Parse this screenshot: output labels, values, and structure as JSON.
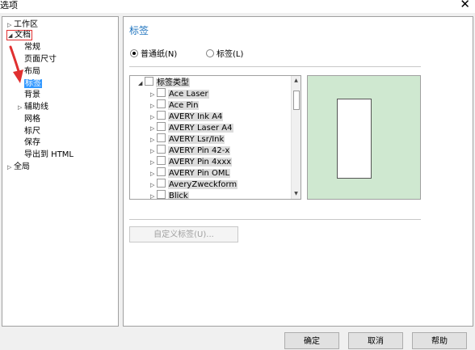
{
  "window": {
    "title": "选项",
    "close_glyph": "✕"
  },
  "tree": {
    "items": [
      {
        "label": "工作区"
      },
      {
        "label": "文档"
      },
      {
        "label": "常规"
      },
      {
        "label": "页面尺寸"
      },
      {
        "label": "布局"
      },
      {
        "label": "标签"
      },
      {
        "label": "背景"
      },
      {
        "label": "辅助线"
      },
      {
        "label": "网格"
      },
      {
        "label": "标尺"
      },
      {
        "label": "保存"
      },
      {
        "label": "导出到 HTML"
      },
      {
        "label": "全局"
      }
    ]
  },
  "section": {
    "heading": "标签",
    "radio_normal": "普通纸(N)",
    "radio_label": "标签(L)"
  },
  "label_types": {
    "root": "标签类型",
    "items": [
      "Ace Laser",
      "Ace Pin",
      "AVERY Ink A4",
      "AVERY Laser A4",
      "AVERY Lsr/Ink",
      "AVERY Pin 42-x",
      "AVERY Pin 4xxx",
      "AVERY Pin OML",
      "AveryZweckform",
      "Blick"
    ]
  },
  "custom_label_button": "自定义标签(U)...",
  "buttons": {
    "ok": "确定",
    "cancel": "取消",
    "help": "帮助"
  },
  "colors": {
    "heading": "#1e73be",
    "preview_background": "#cfe8d0",
    "selection": "#3399ff",
    "annotation_arrow": "#e03030"
  }
}
